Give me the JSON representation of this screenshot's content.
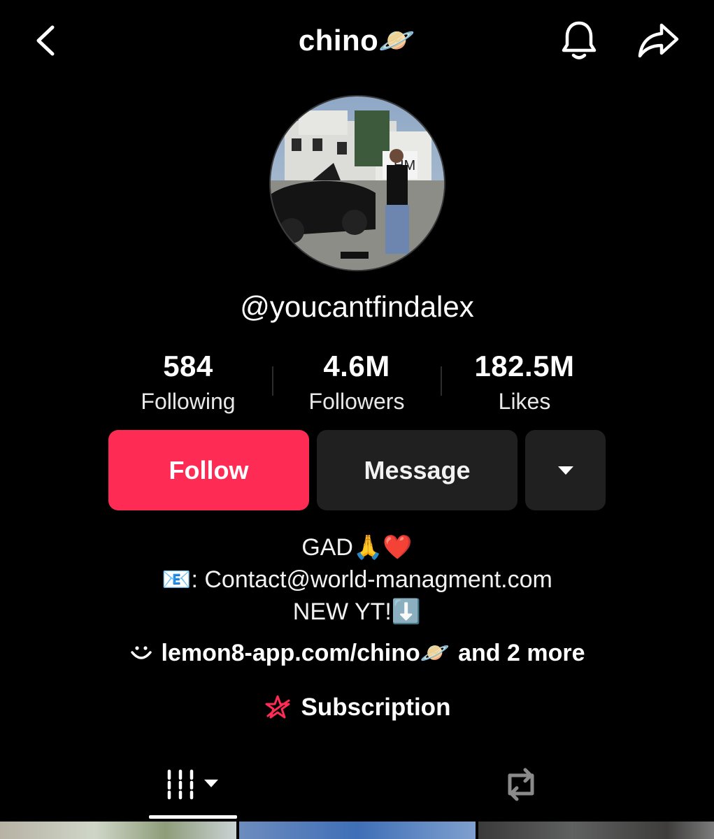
{
  "header": {
    "title": "chino",
    "title_emoji": "🪐",
    "icons": [
      "back-chevron-icon",
      "bell-icon",
      "share-arrow-icon"
    ]
  },
  "profile": {
    "username": "@youcantfindalex",
    "avatar_description": "avatar-photo"
  },
  "stats": [
    {
      "value": "584",
      "label": "Following"
    },
    {
      "value": "4.6M",
      "label": "Followers"
    },
    {
      "value": "182.5M",
      "label": "Likes"
    }
  ],
  "actions": {
    "follow_label": "Follow",
    "message_label": "Message"
  },
  "bio": {
    "line1": "GAD🙏❤️",
    "line2": "📧: Contact@world-managment.com",
    "line3": "NEW YT!⬇️"
  },
  "link": {
    "text": "lemon8-app.com/chino🪐",
    "more": "and 2 more"
  },
  "subscription": {
    "label": "Subscription"
  },
  "colors": {
    "background": "#000000",
    "follow": "#fe2c55",
    "secondary_button": "#202020",
    "subscription_icon": "#fe2c55"
  }
}
